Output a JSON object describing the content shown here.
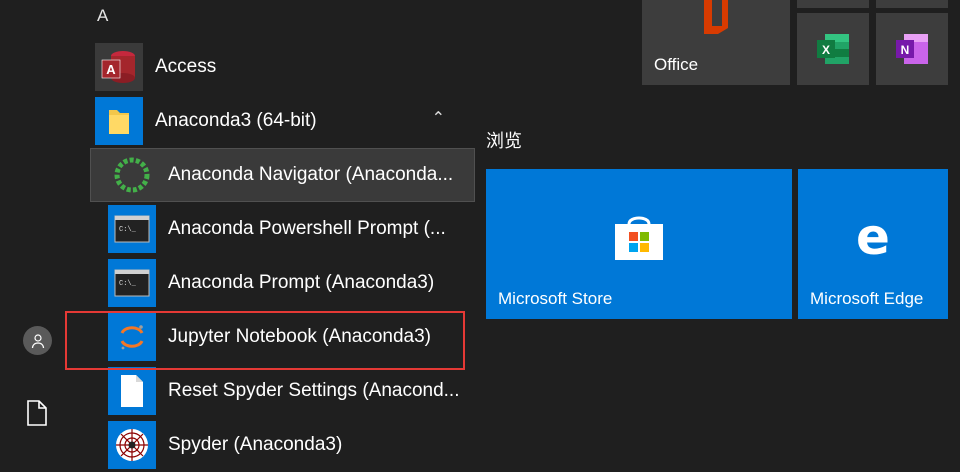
{
  "sidebar": {
    "user": "user-icon",
    "documents": "document-icon"
  },
  "applist": {
    "letter": "A",
    "items": [
      {
        "label": "Access",
        "icon": "access-icon"
      },
      {
        "label": "Anaconda3 (64-bit)",
        "icon": "folder-icon"
      },
      {
        "label": "Anaconda Navigator (Anaconda...",
        "icon": "anaconda-navigator-icon"
      },
      {
        "label": "Anaconda Powershell Prompt (...",
        "icon": "terminal-icon"
      },
      {
        "label": "Anaconda Prompt (Anaconda3)",
        "icon": "terminal-icon"
      },
      {
        "label": "Jupyter Notebook (Anaconda3)",
        "icon": "jupyter-icon"
      },
      {
        "label": "Reset Spyder Settings (Anacond...",
        "icon": "file-icon"
      },
      {
        "label": "Spyder (Anaconda3)",
        "icon": "spyder-icon"
      }
    ]
  },
  "tiles": {
    "group_label": "浏览",
    "office": "Office",
    "store": "Microsoft Store",
    "edge": "Microsoft Edge"
  },
  "colors": {
    "accent": "#0078d7",
    "highlight": "#e53935"
  }
}
